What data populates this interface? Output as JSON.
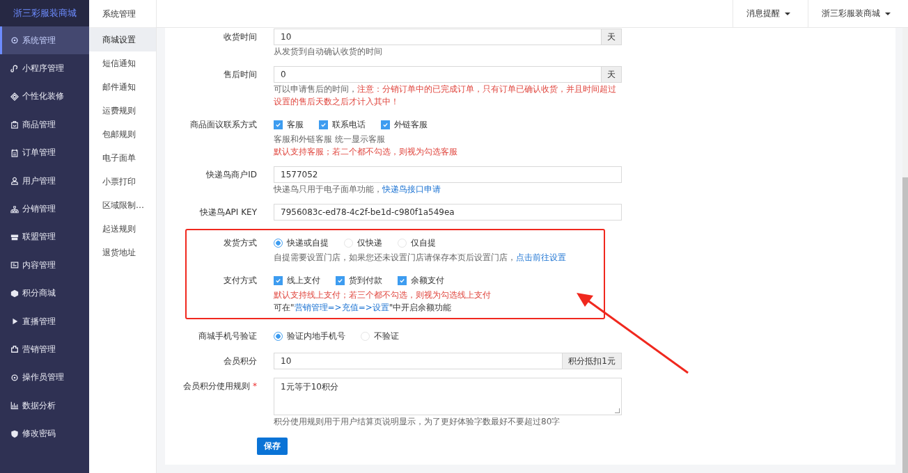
{
  "sidebar": {
    "brand": "浙三彩服装商城",
    "items": [
      {
        "label": "系统管理",
        "selected": true
      },
      {
        "label": "小程序管理",
        "selected": false
      },
      {
        "label": "个性化装修",
        "selected": false
      },
      {
        "label": "商品管理",
        "selected": false
      },
      {
        "label": "订单管理",
        "selected": false
      },
      {
        "label": "用户管理",
        "selected": false
      },
      {
        "label": "分销管理",
        "selected": false
      },
      {
        "label": "联盟管理",
        "selected": false
      },
      {
        "label": "内容管理",
        "selected": false
      },
      {
        "label": "积分商城",
        "selected": false
      },
      {
        "label": "直播管理",
        "selected": false
      },
      {
        "label": "营销管理",
        "selected": false
      },
      {
        "label": "操作员管理",
        "selected": false
      },
      {
        "label": "数据分析",
        "selected": false
      },
      {
        "label": "修改密码",
        "selected": false
      }
    ]
  },
  "subnav": {
    "title": "系统管理",
    "items": [
      {
        "label": "商城设置",
        "selected": true
      },
      {
        "label": "短信通知",
        "selected": false
      },
      {
        "label": "邮件通知",
        "selected": false
      },
      {
        "label": "运费规则",
        "selected": false
      },
      {
        "label": "包邮规则",
        "selected": false
      },
      {
        "label": "电子面单",
        "selected": false
      },
      {
        "label": "小票打印",
        "selected": false
      },
      {
        "label": "区域限制…",
        "selected": false
      },
      {
        "label": "起送规则",
        "selected": false
      },
      {
        "label": "退货地址",
        "selected": false
      }
    ]
  },
  "topbar": {
    "menus": [
      {
        "label": "消息提醒"
      },
      {
        "label": "浙三彩服装商城"
      }
    ]
  },
  "form": {
    "rows": [
      {
        "kind": "input",
        "label": "收货时间",
        "value": "10",
        "addon": "天",
        "hints": [
          [
            {
              "text": "从发货到自动确认收货的时间",
              "kind": "muted"
            }
          ]
        ]
      },
      {
        "kind": "input",
        "label": "售后时间",
        "value": "0",
        "addon": "天",
        "hints": [
          [
            {
              "text": "可以申请售后的时间，",
              "kind": "muted"
            },
            {
              "text": "注意：分销订单中的已完成订单，只有订单已确认收货，并且时间超过设置的售后天数之后才计入其中！",
              "kind": "warning"
            }
          ]
        ]
      },
      {
        "kind": "checks",
        "label": "商品面议联系方式",
        "options": [
          {
            "label": "客服",
            "checked": true
          },
          {
            "label": "联系电话",
            "checked": true
          },
          {
            "label": "外链客服",
            "checked": true
          }
        ],
        "hints": [
          [
            {
              "text": "客服和外链客服 统一显示客服",
              "kind": "muted"
            }
          ],
          [
            {
              "text": "默认支持客服；若二个都不勾选，则视为勾选客服",
              "kind": "warning"
            }
          ]
        ]
      },
      {
        "kind": "input",
        "label": "快递鸟商户ID",
        "value": "1577052",
        "hints": [
          [
            {
              "text": "快递鸟只用于电子面单功能，",
              "kind": "muted"
            },
            {
              "text": "快递鸟接口申请",
              "kind": "link"
            }
          ]
        ]
      },
      {
        "kind": "input",
        "label": "快递鸟API KEY",
        "value": "7956083c-ed78-4c2f-be1d-c980f1a549ea",
        "hints": []
      },
      {
        "kind": "radios",
        "label": "发货方式",
        "highlighted": true,
        "options": [
          {
            "label": "快递或自提",
            "selected": true
          },
          {
            "label": "仅快递",
            "selected": false
          },
          {
            "label": "仅自提",
            "selected": false
          }
        ],
        "hints": [
          [
            {
              "text": "自提需要设置门店，如果您还未设置门店请保存本页后设置门店，",
              "kind": "muted"
            },
            {
              "text": "点击前往设置",
              "kind": "link"
            }
          ]
        ]
      },
      {
        "kind": "checks",
        "label": "支付方式",
        "highlighted": true,
        "options": [
          {
            "label": "线上支付",
            "checked": true
          },
          {
            "label": "货到付款",
            "checked": true
          },
          {
            "label": "余额支付",
            "checked": true
          }
        ],
        "hints": [
          [
            {
              "text": "默认支持线上支付；若三个都不勾选，则视为勾选线上支付",
              "kind": "warning"
            }
          ],
          [
            {
              "text": "可在\"",
              "kind": "dark"
            },
            {
              "text": "营销管理=>充值=>设置",
              "kind": "link"
            },
            {
              "text": "\"中开启余额功能",
              "kind": "dark"
            }
          ]
        ]
      },
      {
        "kind": "radios",
        "label": "商城手机号验证",
        "options": [
          {
            "label": "验证内地手机号",
            "selected": true
          },
          {
            "label": "不验证",
            "selected": false
          }
        ],
        "hints": []
      },
      {
        "kind": "input",
        "label": "会员积分",
        "value": "10",
        "addon": "积分抵扣1元",
        "hints": []
      },
      {
        "kind": "textarea",
        "label": "会员积分使用规则",
        "required_mark": "*",
        "value": "1元等于10积分",
        "hints": [
          [
            {
              "text": "积分使用规则用于用户结算页说明显示，为了更好体验字数最好不要超过80字",
              "kind": "muted"
            }
          ]
        ]
      }
    ],
    "submit": "保存"
  }
}
